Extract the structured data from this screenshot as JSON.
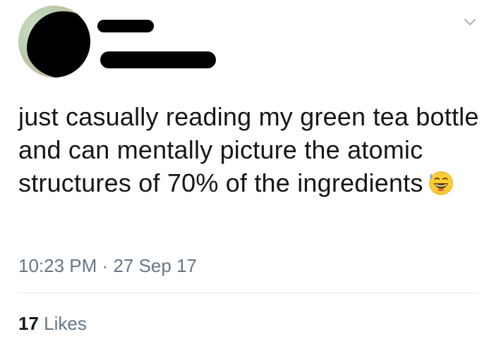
{
  "tweet": {
    "text": "just casually reading my green tea bottle and can mentally picture the atomic structures of 70% of the ingredients",
    "emoji": "grinning-face-with-sweat-emoji",
    "time": "10:23 PM",
    "separator": "·",
    "date": "27 Sep 17",
    "likes_count": "17",
    "likes_label": "Likes"
  },
  "icons": {
    "menu": "chevron-down-icon"
  },
  "colors": {
    "text": "#14171a",
    "secondary": "#657786",
    "divider": "#e1e8ed",
    "emoji_face": "#ffcc33"
  }
}
